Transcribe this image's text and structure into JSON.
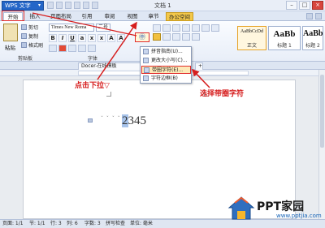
{
  "window": {
    "app_button": "WPS 文字",
    "doc_title": "文档 1",
    "controls": [
      "–",
      "□",
      "×"
    ]
  },
  "ribbon_tabs": [
    "开始",
    "插入",
    "页面布局",
    "引用",
    "审阅",
    "视图",
    "章节",
    "办公空间"
  ],
  "ribbon": {
    "paste_label": "粘贴",
    "cut_label": "剪切",
    "copy_label": "复制",
    "format_painter_label": "格式刷",
    "font_name": "Times New Roma",
    "font_size": "二号",
    "group_clipboard": "剪贴板",
    "group_font": "字体",
    "styles": [
      {
        "sample": "AaBbCcDd",
        "caption": "正文"
      },
      {
        "sample": "AaBb",
        "caption": "标题 1"
      },
      {
        "sample": "AaBb",
        "caption": "标题 2"
      }
    ]
  },
  "doc_tabs": {
    "template_tab": "Docer-在线模板"
  },
  "dropdown": {
    "items": [
      {
        "label": "拼音指南(U)...",
        "icon": "pinyin-icon"
      },
      {
        "label": "更改大小写(C)...",
        "icon": "change-case-icon"
      },
      {
        "label": "带圈字符(E)...",
        "icon": "enclose-char-icon"
      },
      {
        "label": "字符边框(B)",
        "icon": "char-border-icon"
      }
    ],
    "highlighted_index": 2
  },
  "document": {
    "pinyin_marks": "ˇ ˇ ˇ ˇ",
    "text_highlight": "2",
    "text_rest": "345"
  },
  "annotations": {
    "click_dropdown": "点击下拉▽",
    "select_enclosed": "选择带圈字符"
  },
  "statusbar": {
    "page": "页面: 1/1",
    "section": "节: 1/1",
    "row": "行: 3",
    "col": "列: 6",
    "words": "字数: 3",
    "spell": "拼写检查",
    "unit": "单位: 毫米"
  },
  "logo": {
    "text": "PPT家园",
    "url": "www.pptjia.com"
  },
  "colors": {
    "accent_blue": "#2466c8",
    "annotation_red": "#d61e1e",
    "highlight_tab": "#f3c84a"
  }
}
